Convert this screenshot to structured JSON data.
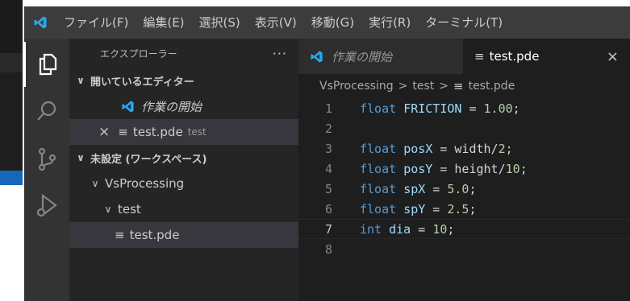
{
  "menu": [
    "ファイル(F)",
    "編集(E)",
    "選択(S)",
    "表示(V)",
    "移動(G)",
    "実行(R)",
    "ターミナル(T)"
  ],
  "activity": [
    "explorer-icon",
    "search-icon",
    "source-control-icon",
    "run-debug-icon"
  ],
  "sidebar": {
    "title": "エクスプローラー",
    "more": "···",
    "open_editors_label": "開いているエディター",
    "open_editors": [
      {
        "label": "作業の開始"
      },
      {
        "label": "test.pde",
        "description": "test",
        "close": "×"
      }
    ],
    "workspace_label": "未設定 (ワークスペース)",
    "tree": [
      {
        "label": "VsProcessing"
      },
      {
        "label": "test"
      },
      {
        "label": "test.pde"
      }
    ]
  },
  "tabs": [
    {
      "label": "作業の開始"
    },
    {
      "label": "test.pde",
      "close": "×"
    }
  ],
  "breadcrumb": [
    "VsProcessing",
    "test",
    "test.pde"
  ],
  "code": [
    {
      "n": "1",
      "kw": "float",
      "id": "FRICTION",
      "rest": " = ",
      "val": "1.00",
      "end": ";"
    },
    {
      "n": "2",
      "kw": "",
      "id": "",
      "rest": "",
      "val": "",
      "end": ""
    },
    {
      "n": "3",
      "kw": "float",
      "id": "posX",
      "rest": " = width/",
      "val": "2",
      "end": ";"
    },
    {
      "n": "4",
      "kw": "float",
      "id": "posY",
      "rest": " = height/",
      "val": "10",
      "end": ";"
    },
    {
      "n": "5",
      "kw": "float",
      "id": "spX",
      "rest": " = ",
      "val": "5.0",
      "end": ";"
    },
    {
      "n": "6",
      "kw": "float",
      "id": "spY",
      "rest": " = ",
      "val": "2.5",
      "end": ";"
    },
    {
      "n": "7",
      "kw": "int",
      "id": "dia",
      "rest": " = ",
      "val": "10",
      "end": ";"
    },
    {
      "n": "8",
      "kw": "",
      "id": "",
      "rest": "",
      "val": "",
      "end": ""
    }
  ],
  "colors": {
    "vscode_blue": "#23a9f2",
    "keyword": "#569cd6",
    "identifier": "#9cdcfe",
    "number": "#b5cea8"
  }
}
